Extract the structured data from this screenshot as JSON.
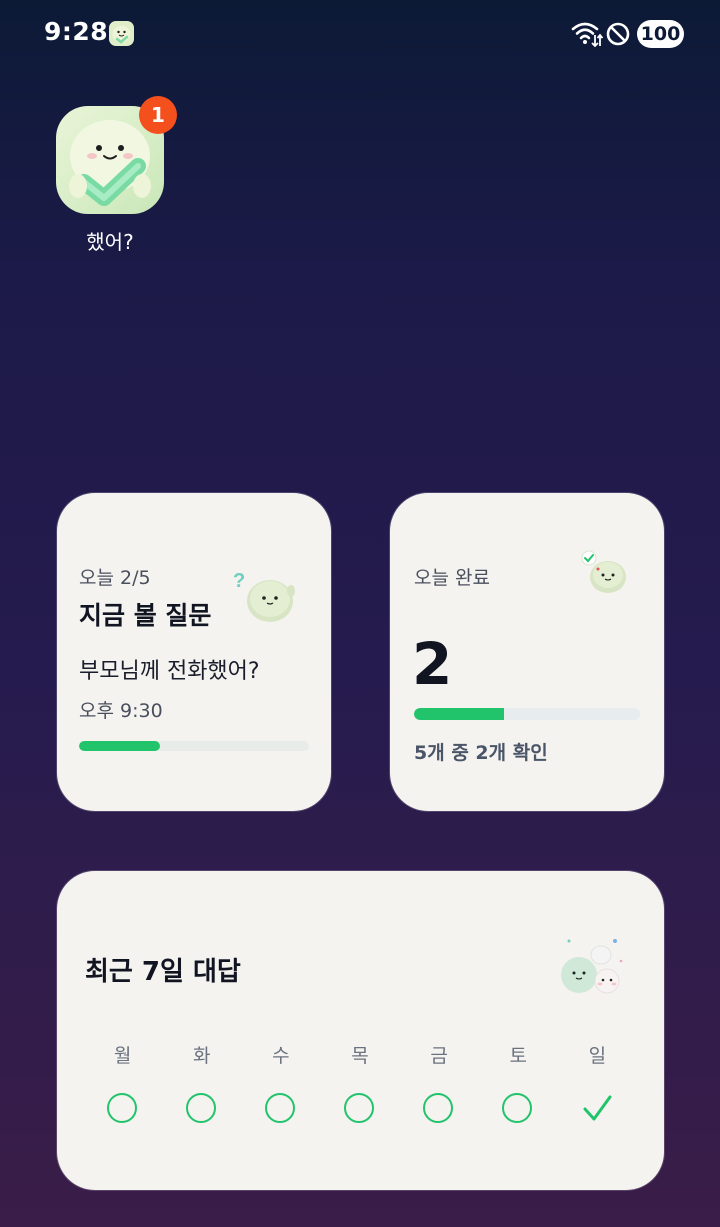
{
  "status_bar": {
    "time": "9:28",
    "battery": "100",
    "icons": [
      "app-mascot-icon",
      "wifi-icon",
      "do-not-disturb-icon"
    ]
  },
  "home": {
    "app_label": "했어?",
    "badge_count": "1",
    "app_icon": "mascot-check-icon"
  },
  "question_widget": {
    "counter": "오늘 2/5",
    "heading": "지금 볼 질문",
    "question": "부모님께 전화했어?",
    "time": "오후 9:30",
    "progress": 0.35
  },
  "done_widget": {
    "heading": "오늘 완료",
    "count": "2",
    "progress": 0.4,
    "summary": "5개 중 2개 확인"
  },
  "week_widget": {
    "heading": "최근 7일 대답",
    "days": [
      {
        "label": "월",
        "state": "empty"
      },
      {
        "label": "화",
        "state": "empty"
      },
      {
        "label": "수",
        "state": "empty"
      },
      {
        "label": "목",
        "state": "empty"
      },
      {
        "label": "금",
        "state": "empty"
      },
      {
        "label": "토",
        "state": "empty"
      },
      {
        "label": "일",
        "state": "checked"
      }
    ]
  },
  "colors": {
    "accent": "#22c46b",
    "badge": "#f4501e",
    "card_bg": "#f4f3ef"
  }
}
